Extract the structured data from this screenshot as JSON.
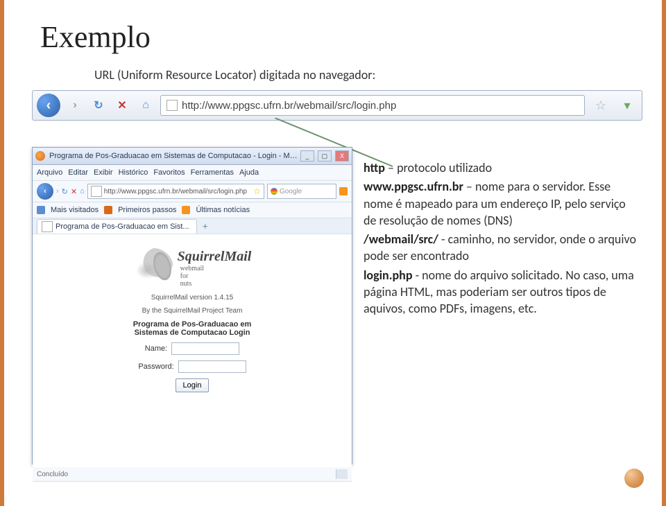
{
  "slide": {
    "title": "Exemplo",
    "caption": "URL (Uniform Resource Locator) digitada no navegador:"
  },
  "urlbar": {
    "url_text": "http://www.ppgsc.ufrn.br/webmail/src/login.php"
  },
  "explain": {
    "http_key": "http",
    "http_text": " – protocolo utilizado",
    "domain_key": "www.ppgsc.ufrn.br",
    "domain_text1": " – nome para o servidor. Esse nome é mapeado para um endereço IP,  pelo serviço de resolução de nomes (DNS)",
    "path_key": "/webmail/src/",
    "path_text": " - caminho, no servidor, onde o arquivo pode ser encontrado",
    "file_key": "login.php",
    "file_text": " - nome do arquivo solicitado. No caso, uma página HTML, mas poderiam ser outros tipos de aquivos, como PDFs, imagens, etc."
  },
  "ff": {
    "title": "Programa de Pos-Graduacao em Sistemas de Computacao - Login - Mozilla Firefox",
    "menu": {
      "arquivo": "Arquivo",
      "editar": "Editar",
      "exibir": "Exibir",
      "historico": "Histórico",
      "favoritos": "Favoritos",
      "ferramentas": "Ferramentas",
      "ajuda": "Ajuda"
    },
    "toolbar_url": "http://www.ppgsc.ufrn.br/webmail/src/login.php",
    "search_placeholder": "Google",
    "bookmarks": {
      "mais": "Mais visitados",
      "primeiros": "Primeiros passos",
      "ultimas": "Últimas notícias"
    },
    "tab_label": "Programa de Pos-Graduacao em Sist...",
    "sq_brand": "SquirrelMail",
    "sq_sub1": "webmail",
    "sq_sub2": "for",
    "sq_sub3": "nuts",
    "sq_version": "SquirrelMail version 1.4.15",
    "sq_team": "By the SquirrelMail Project Team",
    "login_hdr": "Programa de Pos-Graduacao em Sistemas de Computacao Login",
    "name_label": "Name:",
    "pass_label": "Password:",
    "login_btn": "Login",
    "status": "Concluído"
  }
}
